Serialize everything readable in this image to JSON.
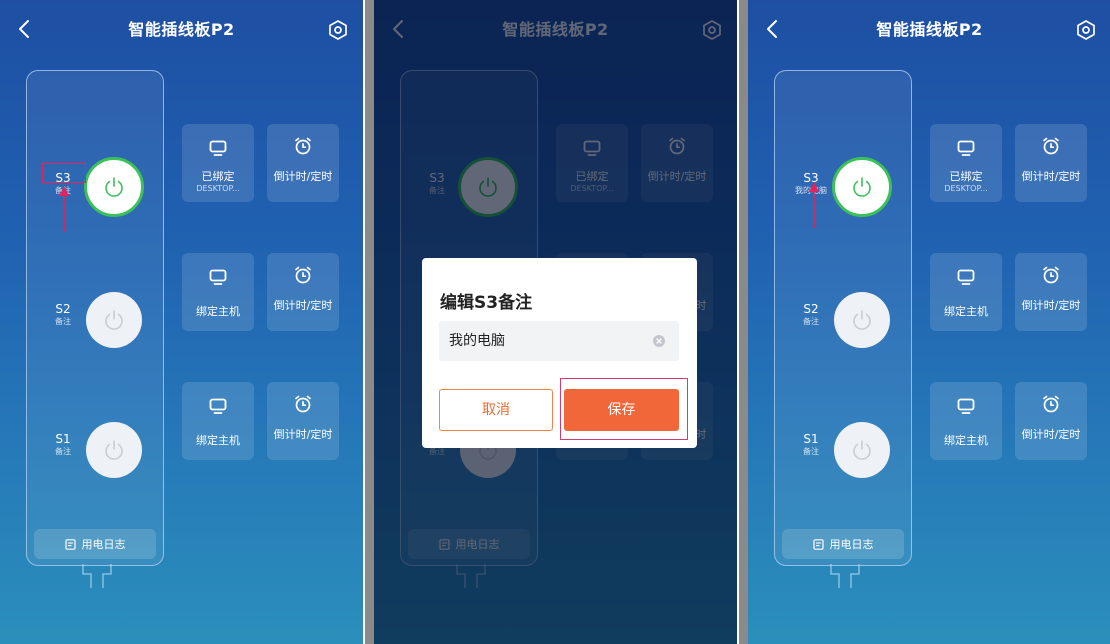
{
  "app": {
    "title": "智能插线板P2"
  },
  "icons": {
    "back": "chevron-left-icon",
    "settings": "hexagon-gear-icon",
    "power": "power-icon",
    "monitor": "monitor-icon",
    "alarm": "alarm-clock-icon",
    "log": "document-icon",
    "clear": "clear-x-circle-icon"
  },
  "colors": {
    "power_on_ring": "#3cc05a",
    "save_button": "#f2673a",
    "cancel_border": "#f0844e",
    "annotation": "#e0245e"
  },
  "panels": [
    {
      "sockets": [
        {
          "name": "S3",
          "note": "备注",
          "on": true,
          "bind_label": "已绑定",
          "bind_sub": "DESKTOP...",
          "timer_label": "倒计时/定时"
        },
        {
          "name": "S2",
          "note": "备注",
          "on": false,
          "bind_label": "绑定主机",
          "bind_sub": "",
          "timer_label": "倒计时/定时"
        },
        {
          "name": "S1",
          "note": "备注",
          "on": false,
          "bind_label": "绑定主机",
          "bind_sub": "",
          "timer_label": "倒计时/定时"
        }
      ],
      "log_label": "用电日志"
    },
    {
      "sockets": [
        {
          "name": "S3",
          "note": "备注",
          "on": true,
          "bind_label": "已绑定",
          "bind_sub": "DESKTOP...",
          "timer_label": "倒计时/定时"
        },
        {
          "name": "S2",
          "note": "备注",
          "on": false,
          "bind_label": "绑定主机",
          "bind_sub": "",
          "timer_label": "倒计时/定时"
        },
        {
          "name": "S1",
          "note": "备注",
          "on": false,
          "bind_label": "绑定主机",
          "bind_sub": "",
          "timer_label": "倒计时/定时"
        }
      ],
      "log_label": "用电日志"
    },
    {
      "sockets": [
        {
          "name": "S3",
          "note": "我的电脑",
          "on": true,
          "bind_label": "已绑定",
          "bind_sub": "DESKTOP...",
          "timer_label": "倒计时/定时"
        },
        {
          "name": "S2",
          "note": "备注",
          "on": false,
          "bind_label": "绑定主机",
          "bind_sub": "",
          "timer_label": "倒计时/定时"
        },
        {
          "name": "S1",
          "note": "备注",
          "on": false,
          "bind_label": "绑定主机",
          "bind_sub": "",
          "timer_label": "倒计时/定时"
        }
      ],
      "log_label": "用电日志"
    }
  ],
  "dialog": {
    "title": "编辑S3备注",
    "input_value": "我的电脑",
    "cancel_label": "取消",
    "save_label": "保存"
  }
}
